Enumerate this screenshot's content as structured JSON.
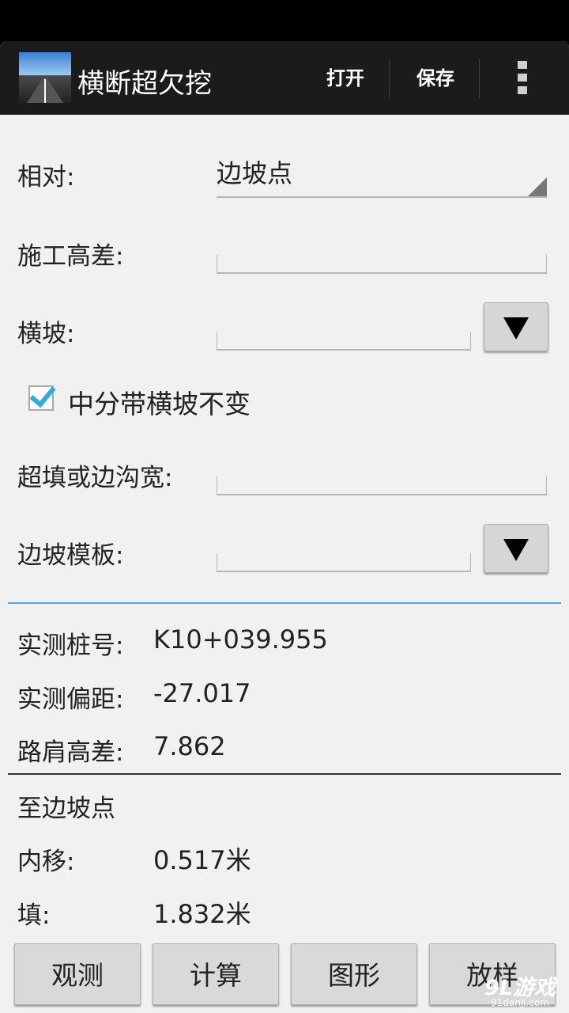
{
  "app": {
    "title": "横断超欠挖",
    "actions": {
      "open": "打开",
      "save": "保存"
    }
  },
  "form": {
    "relative_label": "相对:",
    "relative_value": "边坡点",
    "construction_height_label": "施工高差:",
    "construction_height_value": "",
    "cross_slope_label": "横坡:",
    "cross_slope_value": "",
    "median_checkbox_label": "中分带横坡不变",
    "median_checkbox_checked": true,
    "overfill_label": "超填或边沟宽:",
    "overfill_value": "",
    "slope_template_label": "边坡模板:",
    "slope_template_value": ""
  },
  "measurements": {
    "station_label": "实测桩号:",
    "station_value": "K10+039.955",
    "offset_label": "实测偏距:",
    "offset_value": "-27.017",
    "shoulder_label": "路肩高差:",
    "shoulder_value": "7.862"
  },
  "result": {
    "heading": "至边坡点",
    "inward_label": "内移:",
    "inward_value": "0.517米",
    "fill_label": "填:",
    "fill_value": "1.832米"
  },
  "bottom_buttons": [
    "观测",
    "计算",
    "图形",
    "放样"
  ],
  "watermark": {
    "main": "9L游戏",
    "sub": "91danji.com"
  },
  "colors": {
    "accent": "#33aadd",
    "actionbar": "#1b1b1b",
    "background": "#f1f1f1"
  }
}
